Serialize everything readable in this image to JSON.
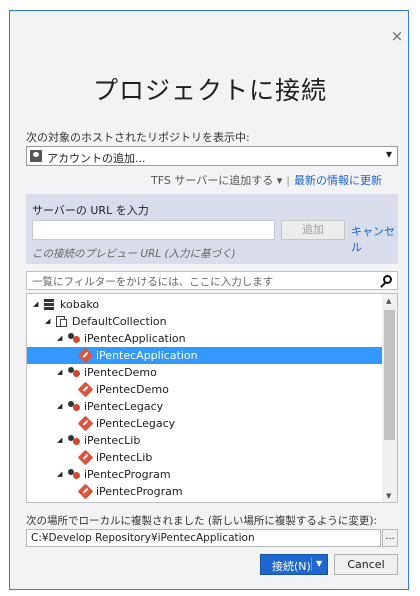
{
  "dialog": {
    "close": "×",
    "title": "プロジェクトに接続",
    "host_label": "次の対象のホストされたリポジトリを表示中:",
    "account_select": "アカウントの追加...",
    "tfs_add": "TFS サーバーに追加する ▾",
    "separator": "|",
    "refresh": "最新の情報に更新",
    "server_label": "サーバーの URL を入力",
    "add_button": "追加",
    "cancel_link": "キャンセル",
    "preview": "この接続のプレビュー URL (入力に基づく)",
    "filter_placeholder": "一覧にフィルターをかけるには、ここに入力します",
    "clone_label": "次の場所でローカルに複製されました (新しい場所に複製するように変更):",
    "clone_path": "C:¥Develop Repository¥iPentecApplication",
    "browse": "...",
    "connect_button": "接続(N)",
    "cancel_button": "Cancel"
  },
  "tree": [
    {
      "label": "kobako",
      "level": 0,
      "expander": "◢",
      "icon": "server-icon"
    },
    {
      "label": "DefaultCollection",
      "level": 1,
      "expander": "◢",
      "icon": "collection-icon"
    },
    {
      "label": "iPentecApplication",
      "level": 2,
      "expander": "◢",
      "icon": "team-project-icon"
    },
    {
      "label": "iPentecApplication",
      "level": 3,
      "expander": "",
      "icon": "git-repo-icon",
      "selected": true
    },
    {
      "label": "iPentecDemo",
      "level": 2,
      "expander": "◢",
      "icon": "team-project-icon"
    },
    {
      "label": "iPentecDemo",
      "level": 3,
      "expander": "",
      "icon": "git-repo-icon"
    },
    {
      "label": "iPentecLegacy",
      "level": 2,
      "expander": "◢",
      "icon": "team-project-icon"
    },
    {
      "label": "iPentecLegacy",
      "level": 3,
      "expander": "",
      "icon": "git-repo-icon"
    },
    {
      "label": "iPentecLib",
      "level": 2,
      "expander": "◢",
      "icon": "team-project-icon"
    },
    {
      "label": "iPentecLib",
      "level": 3,
      "expander": "",
      "icon": "git-repo-icon"
    },
    {
      "label": "iPentecProgram",
      "level": 2,
      "expander": "◢",
      "icon": "team-project-icon"
    },
    {
      "label": "iPentecProgram",
      "level": 3,
      "expander": "",
      "icon": "git-repo-icon"
    }
  ],
  "colors": {
    "accent": "#1f67cf",
    "link": "#1a66c9",
    "selection": "#3399ff",
    "window_border": "#2d7be5"
  }
}
